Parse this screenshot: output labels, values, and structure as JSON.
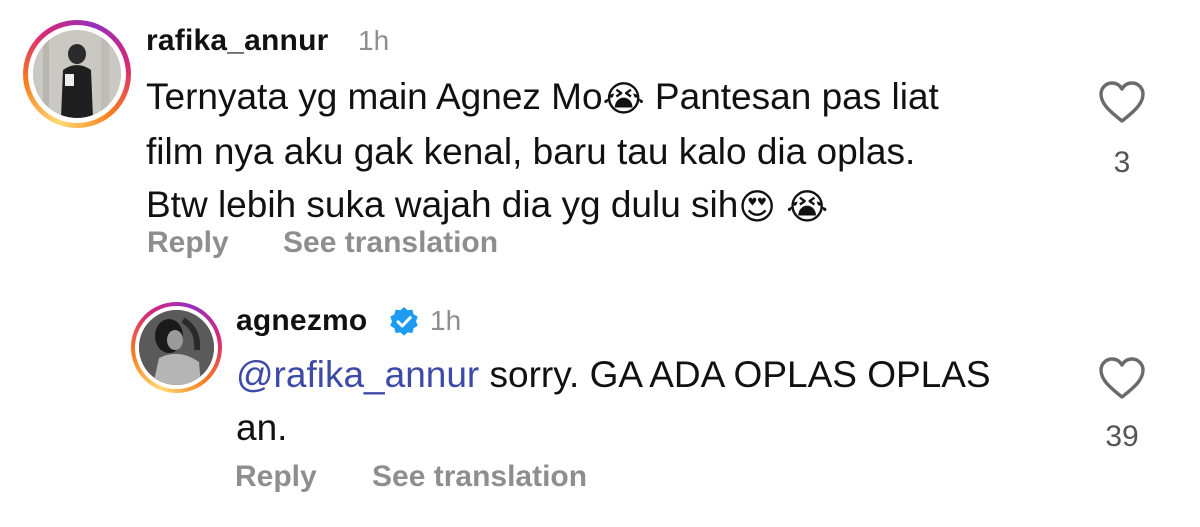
{
  "comments": [
    {
      "username": "rafika_annur",
      "time": "1h",
      "text_lines": [
        "Ternyata yg main Agnez Mo",
        " Pantesan pas liat",
        "film nya aku gak kenal, baru tau kalo dia oplas.",
        "Btw lebih suka wajah dia yg dulu sih"
      ],
      "emojis": [
        "😭",
        "😍",
        "😭"
      ],
      "reply_label": "Reply",
      "translate_label": "See translation",
      "like_count": "3",
      "avatar_icon": "avatar",
      "heart_icon": "heart-outline-icon"
    },
    {
      "username": "agnezmo",
      "time": "1h",
      "verified": true,
      "mention": "@rafika_annur",
      "text": " sorry. GA ADA OPLAS OPLAS",
      "text_line2": "an.",
      "reply_label": "Reply",
      "translate_label": "See translation",
      "like_count": "39",
      "avatar_icon": "avatar",
      "heart_icon": "heart-outline-icon"
    }
  ],
  "colors": {
    "mention": "#3e4aa8",
    "muted": "#8e8e8e",
    "verified": "#1d9bf0"
  }
}
